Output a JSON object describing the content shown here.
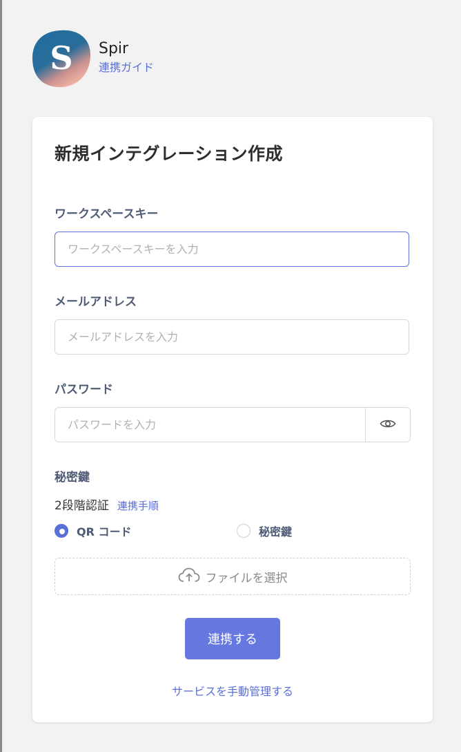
{
  "app": {
    "name": "Spir",
    "guide_link": "連携ガイド",
    "logo_letter": "S"
  },
  "form": {
    "title": "新規インテグレーション作成",
    "workspace_key": {
      "label": "ワークスペースキー",
      "placeholder": "ワークスペースキーを入力",
      "value": ""
    },
    "email": {
      "label": "メールアドレス",
      "placeholder": "メールアドレスを入力",
      "value": ""
    },
    "password": {
      "label": "パスワード",
      "placeholder": "パスワードを入力",
      "value": ""
    },
    "secret_key": {
      "label": "秘密鍵",
      "two_factor_label": "2段階認証",
      "instructions_link": "連携手順",
      "options": [
        {
          "label": "QR コード",
          "selected": true
        },
        {
          "label": "秘密鍵",
          "selected": false
        }
      ],
      "file_select_label": "ファイルを選択"
    },
    "submit_label": "連携する",
    "manual_link": "サービスを手動管理する"
  },
  "colors": {
    "accent": "#5a6fd8",
    "button": "#6678e0",
    "label": "#4f5a74",
    "background": "#f2f2f3"
  }
}
